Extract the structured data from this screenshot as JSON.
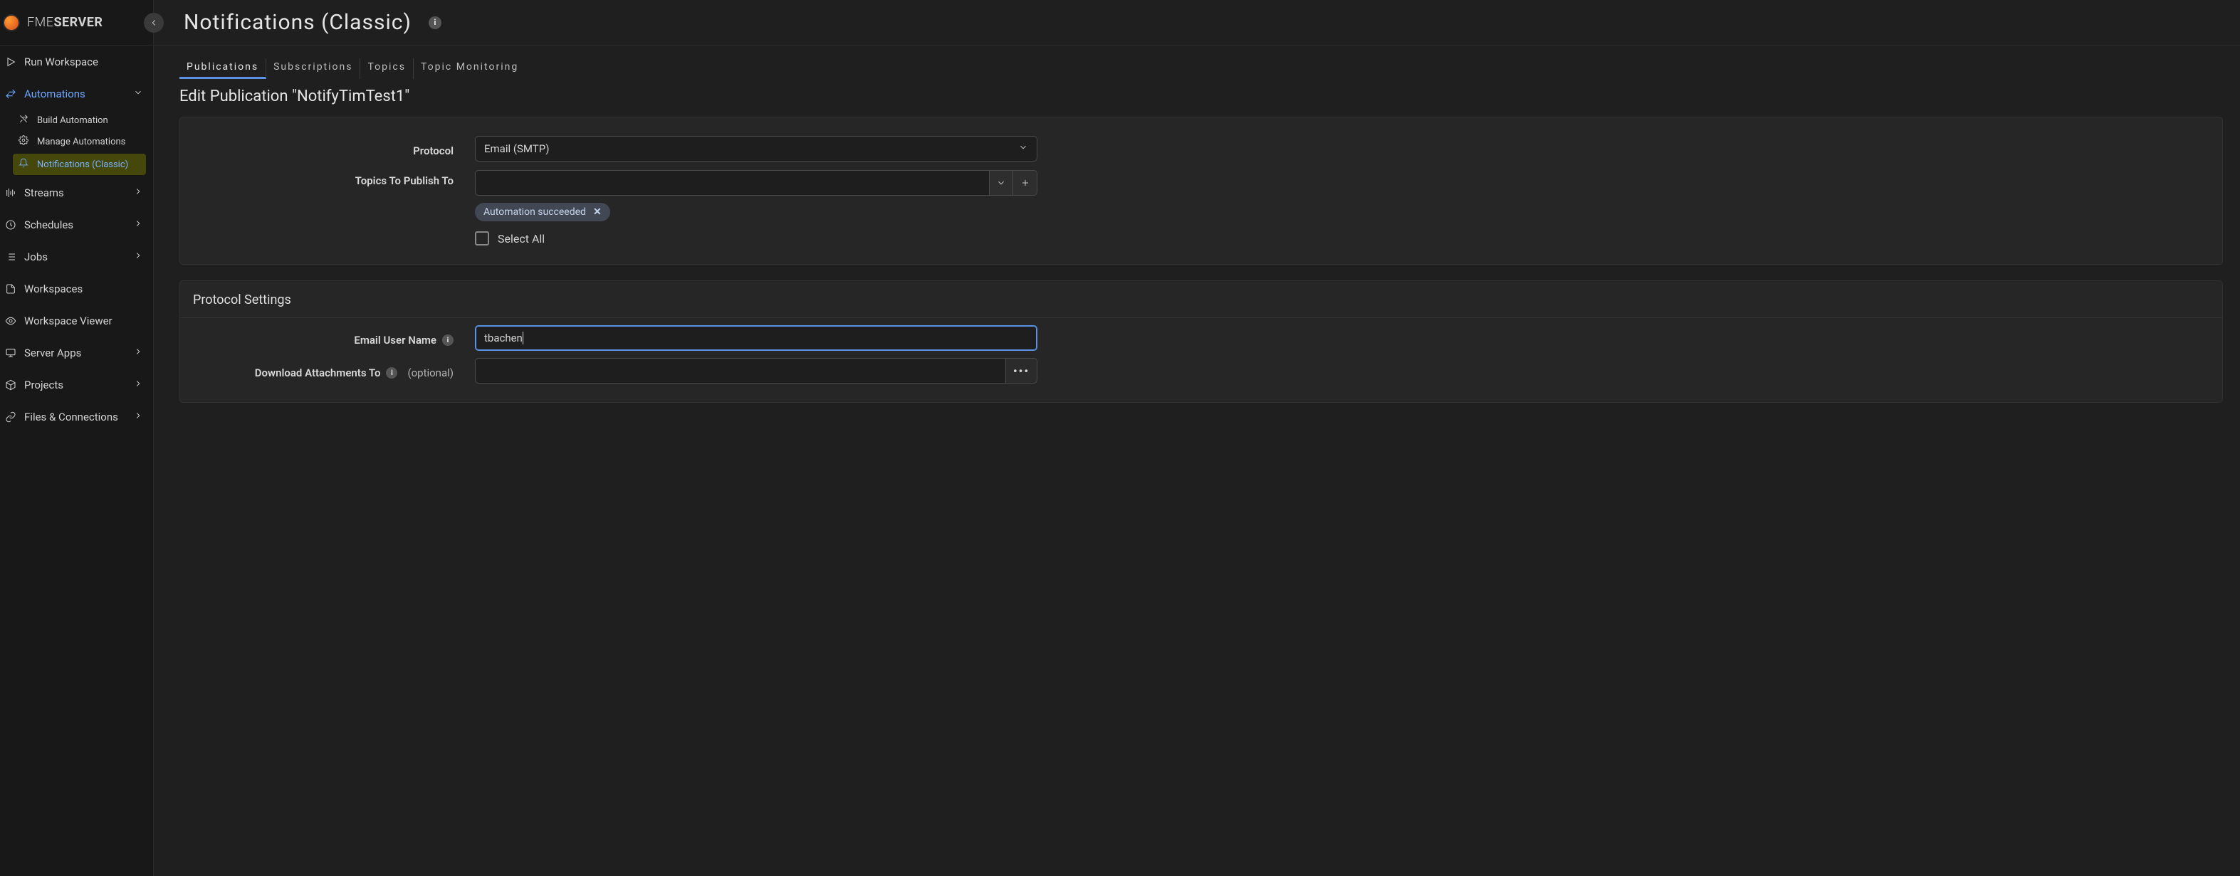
{
  "brand": {
    "thin": "FME",
    "bold": "SERVER"
  },
  "sidebar": {
    "items": {
      "run_workspace": "Run Workspace",
      "automations": "Automations",
      "build_automation": "Build Automation",
      "manage_automations": "Manage Automations",
      "notifications_classic": "Notifications (Classic)",
      "streams": "Streams",
      "schedules": "Schedules",
      "jobs": "Jobs",
      "workspaces": "Workspaces",
      "workspace_viewer": "Workspace Viewer",
      "server_apps": "Server Apps",
      "projects": "Projects",
      "files_connections": "Files & Connections"
    }
  },
  "header": {
    "title": "Notifications (Classic)"
  },
  "tabs": {
    "publications": "Publications",
    "subscriptions": "Subscriptions",
    "topics": "Topics",
    "topic_monitoring": "Topic Monitoring"
  },
  "page": {
    "edit_heading": "Edit Publication \"NotifyTimTest1\""
  },
  "form": {
    "protocol_label": "Protocol",
    "protocol_value": "Email (SMTP)",
    "topics_label": "Topics To Publish To",
    "topics_chip_0": "Automation succeeded",
    "select_all_label": "Select All",
    "protocol_settings_heading": "Protocol Settings",
    "email_user_label": "Email User Name",
    "email_user_value": "tbachen",
    "download_label": "Download Attachments To",
    "optional_text": "(optional)"
  }
}
